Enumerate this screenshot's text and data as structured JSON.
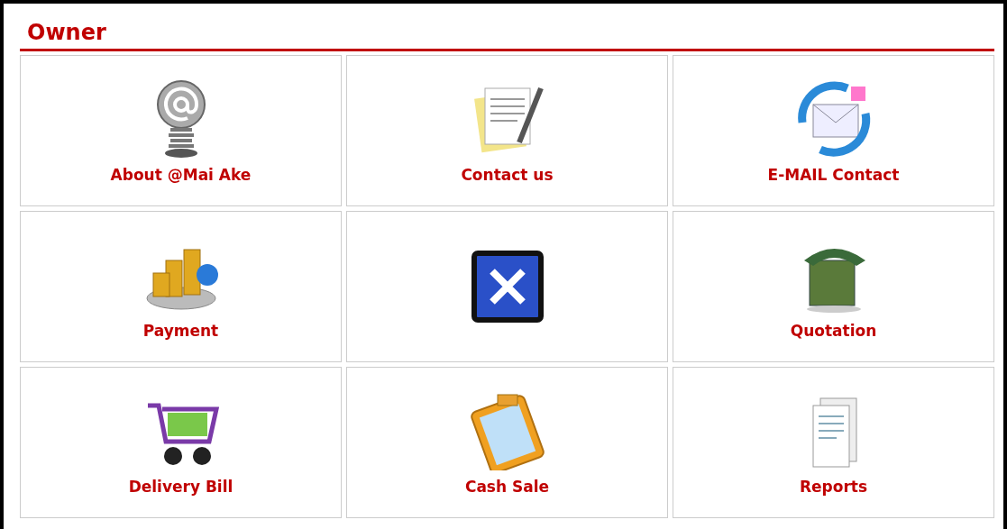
{
  "panel": {
    "title": "Owner"
  },
  "tiles": [
    {
      "kind": "labeled",
      "label": "About @Mai Ake"
    },
    {
      "kind": "labeled",
      "label": "Contact us"
    },
    {
      "kind": "labeled",
      "label": "E-MAIL Contact"
    },
    {
      "kind": "labeled",
      "label": "Payment"
    },
    {
      "kind": "icon"
    },
    {
      "kind": "labeled",
      "label": "Quotation"
    },
    {
      "kind": "labeled",
      "label": "Delivery Bill"
    },
    {
      "kind": "labeled",
      "label": "Cash Sale"
    },
    {
      "kind": "labeled",
      "label": "Reports"
    }
  ]
}
